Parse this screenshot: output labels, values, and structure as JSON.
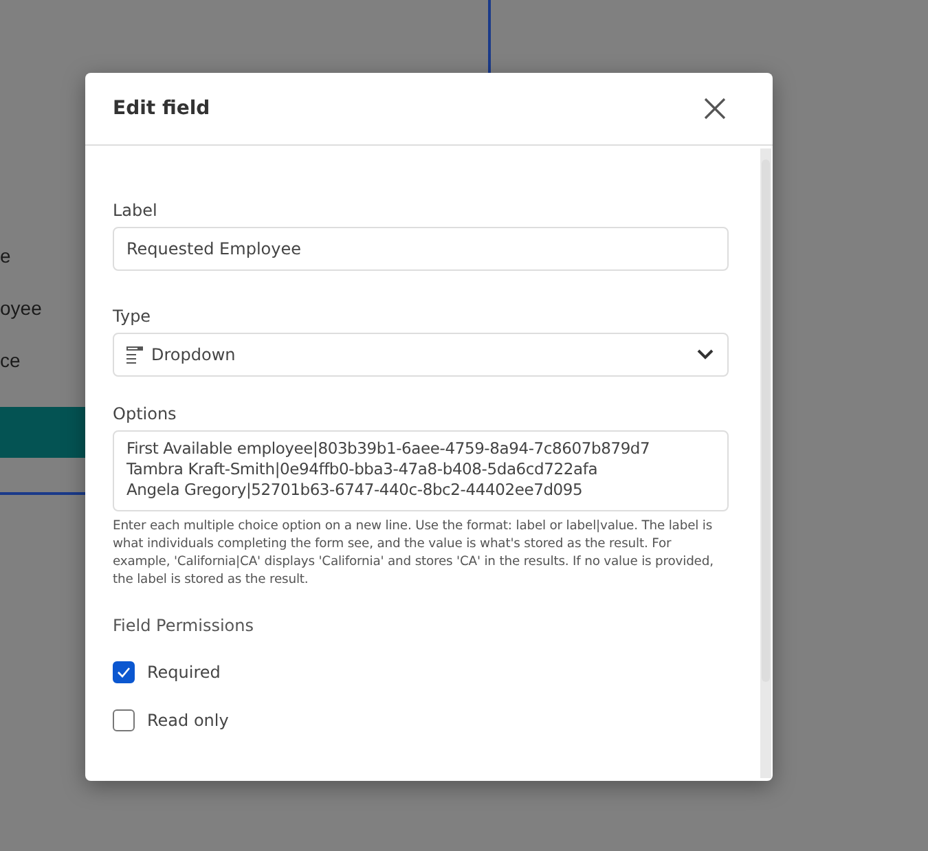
{
  "background": {
    "texts": [
      "e",
      "oyee",
      "ce"
    ]
  },
  "dialog": {
    "title": "Edit field",
    "label_field": {
      "label": "Label",
      "value": "Requested Employee"
    },
    "type_field": {
      "label": "Type",
      "value": "Dropdown"
    },
    "options_field": {
      "label": "Options",
      "lines": [
        "First Available employee|803b39b1-6aee-4759-8a94-7c8607b879d7",
        "Tambra Kraft-Smith|0e94ffb0-bba3-47a8-b408-5da6cd722afa",
        "Angela Gregory|52701b63-6747-440c-8bc2-44402ee7d095"
      ],
      "help": "Enter each multiple choice option on a new line. Use the format: label or label|value. The label is what individuals completing the form see, and the value is what's stored as the result. For example, 'California|CA' displays 'California' and stores 'CA' in the results. If no value is provided, the label is stored as the result."
    },
    "permissions": {
      "title": "Field Permissions",
      "items": [
        {
          "label": "Required",
          "checked": true
        },
        {
          "label": "Read only",
          "checked": false
        }
      ]
    }
  }
}
